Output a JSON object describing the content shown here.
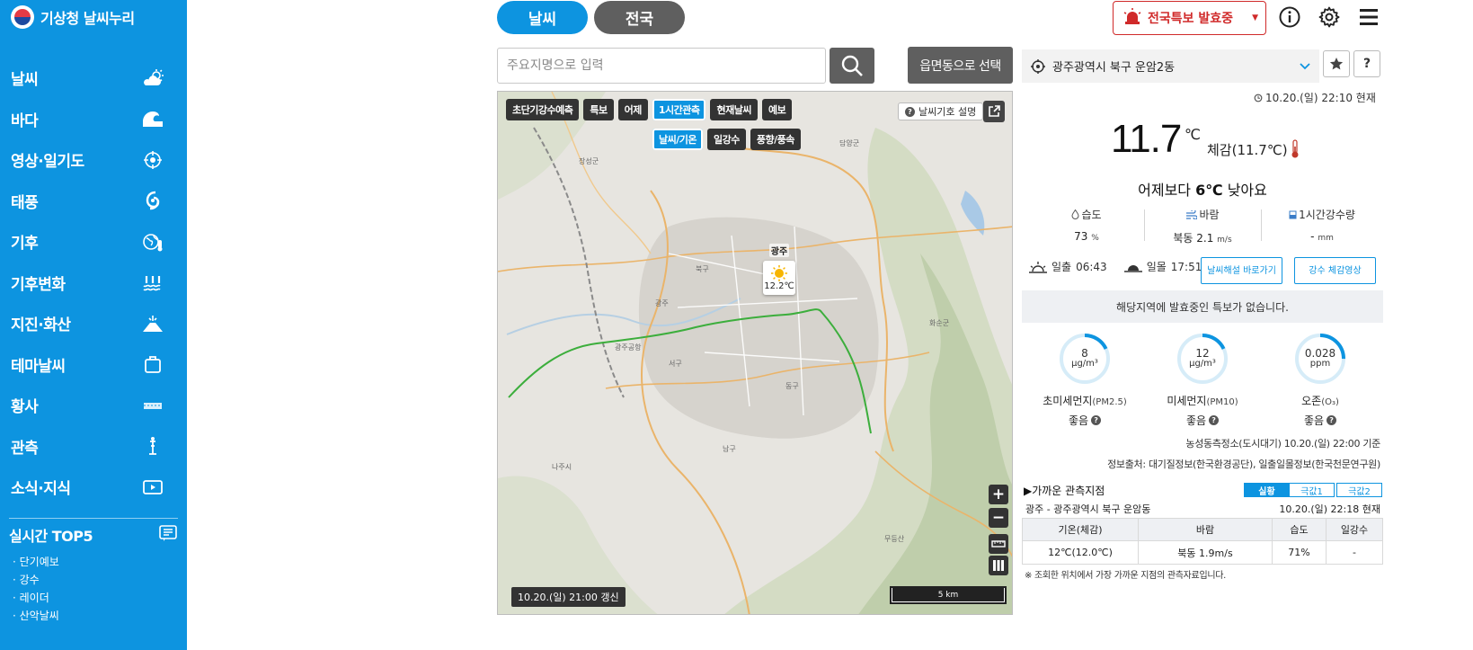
{
  "brand": {
    "name": "기상청 날씨누리"
  },
  "sidebar": {
    "items": [
      {
        "label": "날씨",
        "icon": "weather-cloud-sun-icon"
      },
      {
        "label": "바다",
        "icon": "wave-icon"
      },
      {
        "label": "영상·일기도",
        "icon": "satellite-target-icon"
      },
      {
        "label": "태풍",
        "icon": "typhoon-icon"
      },
      {
        "label": "기후",
        "icon": "globe-thermometer-icon"
      },
      {
        "label": "기후변화",
        "icon": "heat-waves-icon"
      },
      {
        "label": "지진·화산",
        "icon": "volcano-icon"
      },
      {
        "label": "테마날씨",
        "icon": "suitcase-icon"
      },
      {
        "label": "황사",
        "icon": "dust-icon"
      },
      {
        "label": "관측",
        "icon": "observation-tower-icon"
      },
      {
        "label": "소식·지식",
        "icon": "play-video-icon"
      }
    ],
    "top5": {
      "title": "실시간 TOP5",
      "items": [
        "· 단기예보",
        "· 강수",
        "· 레이더",
        "· 산악날씨"
      ]
    }
  },
  "topbar": {
    "tab_weather": "날씨",
    "tab_nation": "전국",
    "alert_label": "전국특보 발효중"
  },
  "search": {
    "placeholder": "주요지명으로 입력",
    "area_button": "읍면동으로 선택"
  },
  "map": {
    "buttons_row1": [
      "초단기강수예측",
      "특보",
      "어제",
      "1시간관측",
      "현재날씨",
      "예보"
    ],
    "active_row1": "1시간관측",
    "buttons_row2": [
      "날씨/기온",
      "일강수",
      "풍향/풍속"
    ],
    "active_row2": "날씨/기온",
    "legend_label": "날씨기호 설명",
    "marker": {
      "city": "광주",
      "temp": "12.2℃",
      "icon": "sun-icon"
    },
    "updated": "10.20.(일) 21:00 갱신",
    "scale": "5 km",
    "place_labels": [
      "광주",
      "광주공항",
      "서구",
      "남구",
      "북구",
      "동구",
      "장성군",
      "담양군",
      "화순군",
      "나주시",
      "무등산"
    ]
  },
  "location": {
    "name": "광주광역시 북구 운암2동"
  },
  "current": {
    "time": "10.20.(일) 22:10 현재",
    "temp": "11.7",
    "unit": "℃",
    "feels": "체감(11.7℃)",
    "compare_prefix": "어제보다 ",
    "compare_value": "6℃",
    "compare_suffix": " 낮아요",
    "humidity_label": "습도",
    "humidity_value": "73",
    "humidity_unit": "%",
    "wind_label": "바람",
    "wind_value": "북동 2.1",
    "wind_unit": "m/s",
    "rain_label": "1시간강수량",
    "rain_value": "-",
    "rain_unit": "mm",
    "sunrise_label": "일출",
    "sunrise_time": "06:43",
    "sunset_label": "일몰",
    "sunset_time": "17:51",
    "btn_commentary": "날씨해설 바로가기",
    "btn_rain_video": "강수 체감영상"
  },
  "warning": {
    "text": "해당지역에 발효중인 특보가 없습니다."
  },
  "air": [
    {
      "value": "8",
      "unit": "μg/m³",
      "name": "초미세먼지",
      "sub": "(PM2.5)",
      "grade": "좋음",
      "fill": 0.18
    },
    {
      "value": "12",
      "unit": "μg/m³",
      "name": "미세먼지",
      "sub": "(PM10)",
      "grade": "좋음",
      "fill": 0.18
    },
    {
      "value": "0.028",
      "unit": "ppm",
      "name": "오존",
      "sub": "(O₃)",
      "grade": "좋음",
      "fill": 0.25
    }
  ],
  "air_notes": {
    "station": "농성동측정소(도시대기) 10.20.(일) 22:00 기준",
    "source": "정보출처: 대기질정보(한국환경공단), 일출일몰정보(한국천문연구원)"
  },
  "nearby": {
    "title": "▶가까운 관측지점",
    "tabs": [
      "실황",
      "극값1",
      "극값2"
    ],
    "active_tab": "실황",
    "station": "광주 - 광주광역시 북구 운암동",
    "time": "10.20.(일) 22:18 현재",
    "headers": [
      "기온(체감)",
      "바람",
      "습도",
      "일강수"
    ],
    "row": [
      "12℃(12.0℃)",
      "북동 1.9m/s",
      "71%",
      "-"
    ],
    "note": "※ 조회한 위치에서 가장 가까운 지점의 관측자료입니다."
  },
  "colors": {
    "primary": "#0d94e0",
    "dark_button": "#5f5f5f",
    "alert": "#d02a2a",
    "route": "#3cae3c"
  }
}
